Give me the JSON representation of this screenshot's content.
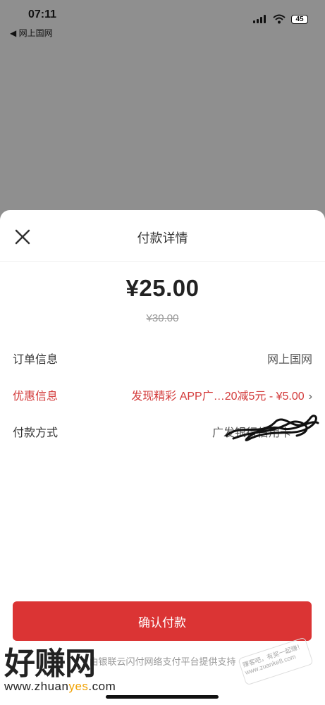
{
  "status_bar": {
    "time": "07:11",
    "back_app": "◀ 网上国网",
    "battery": "45"
  },
  "sheet": {
    "title": "付款详情",
    "amount": "¥25.00",
    "original_amount": "¥30.00",
    "rows": [
      {
        "label": "订单信息",
        "value": "网上国网"
      },
      {
        "label": "优惠信息",
        "value": "发现精彩 APP广…20减5元 - ¥5.00"
      },
      {
        "label": "付款方式",
        "value": "广发银行信用卡"
      }
    ],
    "confirm_label": "确认付款",
    "footer": "由银联云闪付网络支付平台提供支持"
  },
  "watermark": {
    "text": "好赚网",
    "url_prefix": "www.zhuan",
    "url_highlight": "yes",
    "url_suffix": ".com",
    "stamp": "赚客吧，有奖一起赚！ www.zuanke8.com"
  },
  "colors": {
    "accent": "#db3434",
    "promo": "#d33b3b",
    "overlay": "#8f8f8f"
  }
}
